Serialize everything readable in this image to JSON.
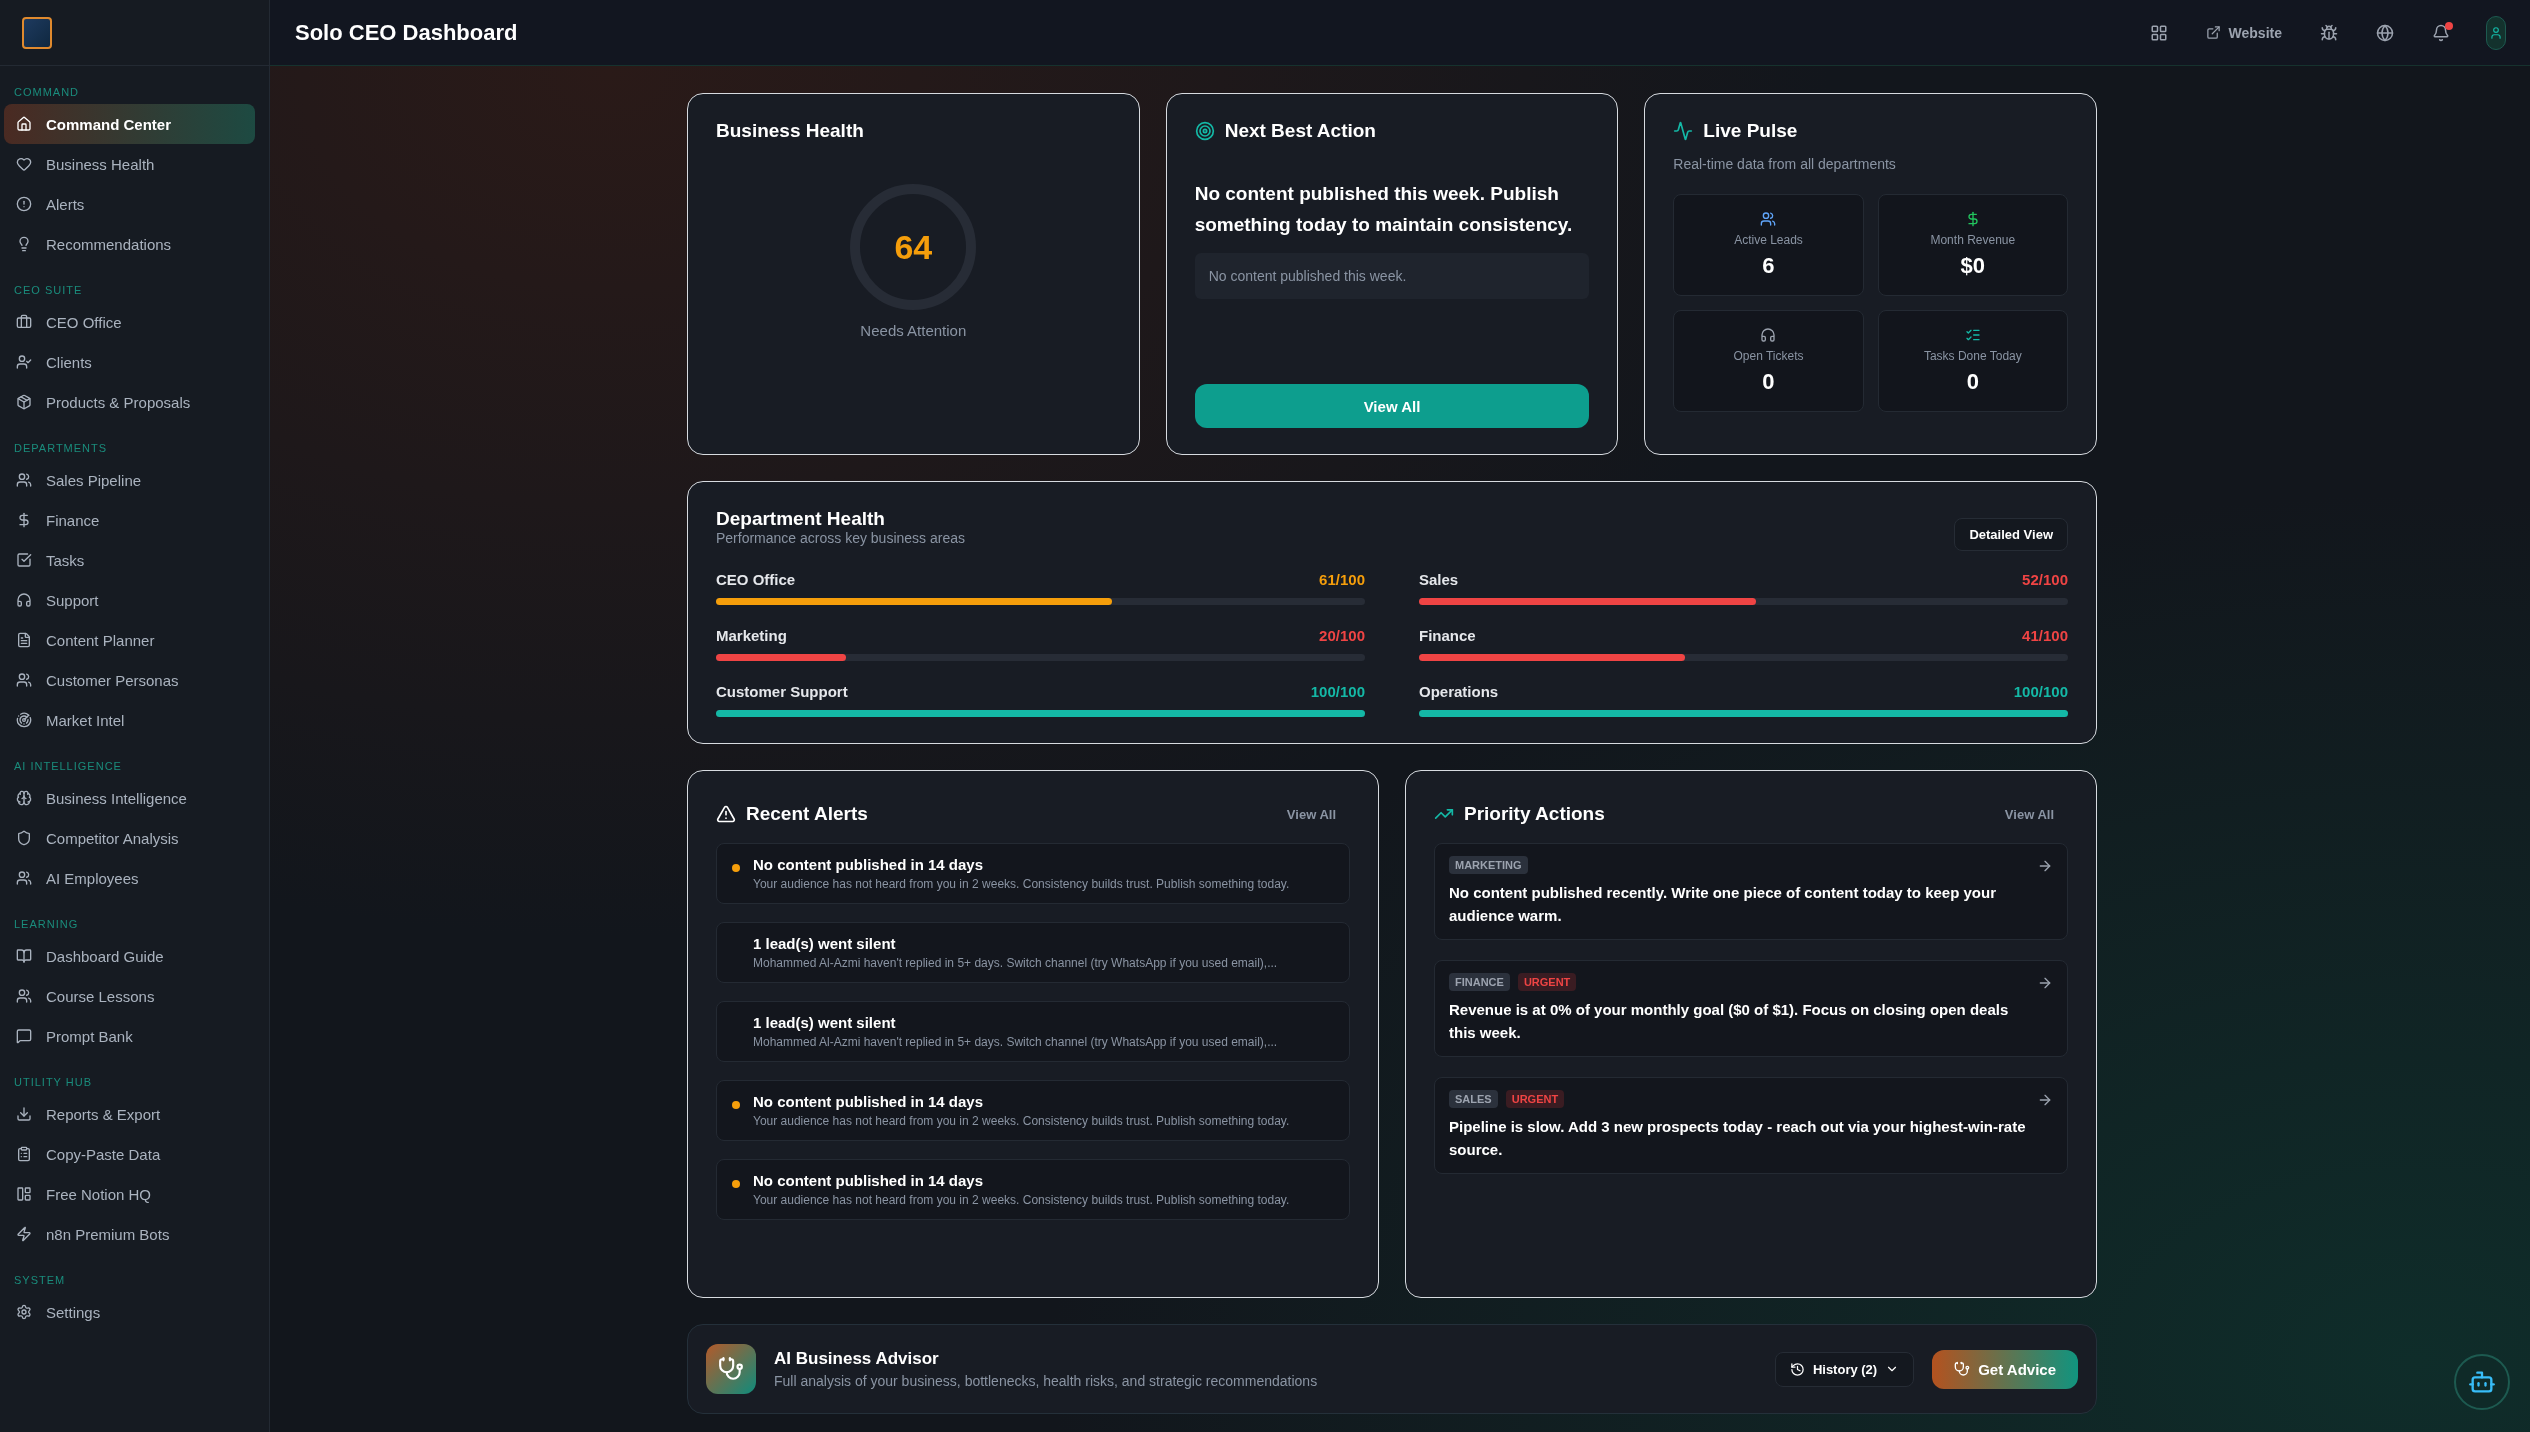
{
  "header": {
    "title": "Solo CEO Dashboard",
    "website_link": "Website",
    "notifications_unread": true
  },
  "sidebar": {
    "sections": [
      {
        "heading": "COMMAND",
        "items": [
          {
            "label": "Command Center",
            "selected": true
          },
          {
            "label": "Business Health",
            "selected": false
          },
          {
            "label": "Alerts",
            "selected": false
          },
          {
            "label": "Recommendations",
            "selected": false
          }
        ]
      },
      {
        "heading": "CEO SUITE",
        "items": [
          {
            "label": "CEO Office",
            "selected": false
          },
          {
            "label": "Clients",
            "selected": false
          },
          {
            "label": "Products & Proposals",
            "selected": false
          }
        ]
      },
      {
        "heading": "DEPARTMENTS",
        "items": [
          {
            "label": "Sales Pipeline",
            "selected": false
          },
          {
            "label": "Finance",
            "selected": false
          },
          {
            "label": "Tasks",
            "selected": false
          },
          {
            "label": "Support",
            "selected": false
          },
          {
            "label": "Content Planner",
            "selected": false
          },
          {
            "label": "Customer Personas",
            "selected": false
          },
          {
            "label": "Market Intel",
            "selected": false
          }
        ]
      },
      {
        "heading": "AI INTELLIGENCE",
        "items": [
          {
            "label": "Business Intelligence",
            "selected": false
          },
          {
            "label": "Competitor Analysis",
            "selected": false
          },
          {
            "label": "AI Employees",
            "selected": false
          }
        ]
      },
      {
        "heading": "LEARNING",
        "items": [
          {
            "label": "Dashboard Guide",
            "selected": false
          },
          {
            "label": "Course Lessons",
            "selected": false
          },
          {
            "label": "Prompt Bank",
            "selected": false
          }
        ]
      },
      {
        "heading": "UTILITY HUB",
        "items": [
          {
            "label": "Reports & Export",
            "selected": false
          },
          {
            "label": "Copy-Paste Data",
            "selected": false
          },
          {
            "label": "Free Notion HQ",
            "selected": false
          },
          {
            "label": "n8n Premium Bots",
            "selected": false
          }
        ]
      },
      {
        "heading": "SYSTEM",
        "items": [
          {
            "label": "Settings",
            "selected": false
          }
        ]
      }
    ]
  },
  "business_health": {
    "title": "Business Health",
    "score": "64",
    "status": "Needs Attention"
  },
  "next_best_action": {
    "title": "Next Best Action",
    "message": "No content published this week. Publish something today to maintain consistency.",
    "detail": "No content published this week.",
    "button": "View All"
  },
  "live_pulse": {
    "title": "Live Pulse",
    "subtitle": "Real-time data from all departments",
    "stats": [
      {
        "label": "Active Leads",
        "value": "6",
        "color": "#60a5fa"
      },
      {
        "label": "Month Revenue",
        "value": "$0",
        "color": "#22c55e"
      },
      {
        "label": "Open Tickets",
        "value": "0",
        "color": "#9ca3af"
      },
      {
        "label": "Tasks Done Today",
        "value": "0",
        "color": "#14b8a6"
      }
    ]
  },
  "department_health": {
    "title": "Department Health",
    "subtitle": "Performance across key business areas",
    "button": "Detailed View",
    "departments": [
      {
        "name": "CEO Office",
        "score": "61/100",
        "level": 0.61,
        "color": "#f59e0b"
      },
      {
        "name": "Sales",
        "score": "52/100",
        "level": 0.52,
        "color": "#ef4444"
      },
      {
        "name": "Marketing",
        "score": "20/100",
        "level": 0.2,
        "color": "#ef4444"
      },
      {
        "name": "Finance",
        "score": "41/100",
        "level": 0.41,
        "color": "#ef4444"
      },
      {
        "name": "Customer Support",
        "score": "100/100",
        "level": 1,
        "color": "#14b8a6"
      },
      {
        "name": "Operations",
        "score": "100/100",
        "level": 1,
        "color": "#14b8a6"
      }
    ]
  },
  "recent_alerts": {
    "title": "Recent Alerts",
    "link": "View All",
    "alerts": [
      {
        "title": "No content published in 14 days",
        "text": "Your audience has not heard from you in 2 weeks. Consistency builds trust. Publish something today.",
        "dot": true
      },
      {
        "title": "1 lead(s) went silent",
        "text": "Mohammed Al-Azmi haven't replied in 5+ days. Switch channel (try WhatsApp if you used email),...",
        "dot": false
      },
      {
        "title": "1 lead(s) went silent",
        "text": "Mohammed Al-Azmi haven't replied in 5+ days. Switch channel (try WhatsApp if you used email),...",
        "dot": false
      },
      {
        "title": "No content published in 14 days",
        "text": "Your audience has not heard from you in 2 weeks. Consistency builds trust. Publish something today.",
        "dot": true
      },
      {
        "title": "No content published in 14 days",
        "text": "Your audience has not heard from you in 2 weeks. Consistency builds trust. Publish something today.",
        "dot": true
      }
    ]
  },
  "priority_actions": {
    "title": "Priority Actions",
    "link": "View All",
    "actions": [
      {
        "tags": [
          {
            "label": "MARKETING",
            "kind": "category"
          }
        ],
        "text": "No content published recently. Write one piece of content today to keep your audience warm."
      },
      {
        "tags": [
          {
            "label": "FINANCE",
            "kind": "category"
          },
          {
            "label": "URGENT",
            "kind": "urgent"
          }
        ],
        "text": "Revenue is at 0% of your monthly goal ($0 of $1). Focus on closing open deals this week."
      },
      {
        "tags": [
          {
            "label": "SALES",
            "kind": "category"
          },
          {
            "label": "URGENT",
            "kind": "urgent"
          }
        ],
        "text": "Pipeline is slow. Add 3 new prospects today - reach out via your highest-win-rate source."
      }
    ]
  },
  "ai_advisor": {
    "title": "AI Business Advisor",
    "subtitle": "Full analysis of your business, bottlenecks, health risks, and strategic recommendations",
    "history": "History (2)",
    "button": "Get Advice"
  }
}
